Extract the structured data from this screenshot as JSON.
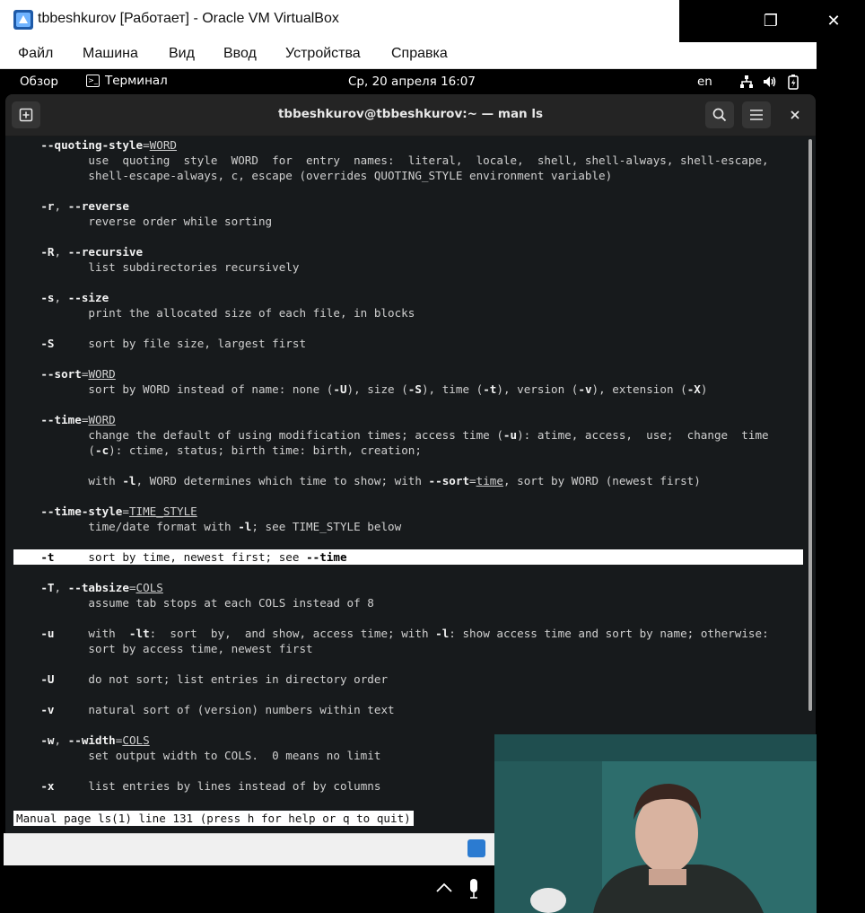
{
  "window": {
    "title": "tbbeshkurov [Работает] - Oracle VM VirtualBox",
    "controls": [
      "—",
      "❐",
      "✕"
    ]
  },
  "menubar": [
    "Файл",
    "Машина",
    "Вид",
    "Ввод",
    "Устройства",
    "Справка"
  ],
  "gnome_topbar": {
    "overview": "Обзор",
    "app": "Терминал",
    "clock": "Ср, 20 апреля  16:07",
    "lang": "en"
  },
  "terminal": {
    "title": "tbbeshkurov@tbbeshkurov:~ — man ls",
    "lines": [
      {
        "html": "    <b>--quoting-style</b>=<u>WORD</u>"
      },
      {
        "html": "           use  quoting  style  WORD  for  entry  names:  literal,  locale,  shell, shell-always, shell-escape,"
      },
      {
        "html": "           shell-escape-always, c, escape (overrides QUOTING_STYLE environment variable)"
      },
      {
        "html": ""
      },
      {
        "html": "    <b>-r</b>, <b>--reverse</b>"
      },
      {
        "html": "           reverse order while sorting"
      },
      {
        "html": ""
      },
      {
        "html": "    <b>-R</b>, <b>--recursive</b>"
      },
      {
        "html": "           list subdirectories recursively"
      },
      {
        "html": ""
      },
      {
        "html": "    <b>-s</b>, <b>--size</b>"
      },
      {
        "html": "           print the allocated size of each file, in blocks"
      },
      {
        "html": ""
      },
      {
        "html": "    <b>-S</b>     sort by file size, largest first"
      },
      {
        "html": ""
      },
      {
        "html": "    <b>--sort</b>=<u>WORD</u>"
      },
      {
        "html": "           sort by WORD instead of name: none (<b>-U</b>), size (<b>-S</b>), time (<b>-t</b>), version (<b>-v</b>), extension (<b>-X</b>)"
      },
      {
        "html": ""
      },
      {
        "html": "    <b>--time</b>=<u>WORD</u>"
      },
      {
        "html": "           change the default of using modification times; access time (<b>-u</b>): atime, access,  use;  change  time"
      },
      {
        "html": "           (<b>-c</b>): ctime, status; birth time: birth, creation;"
      },
      {
        "html": ""
      },
      {
        "html": "           with <b>-l</b>, WORD determines which time to show; with <b>--sort</b>=<u>time</u>, sort by WORD (newest first)"
      },
      {
        "html": ""
      },
      {
        "html": "    <b>--time-style</b>=<u>TIME_STYLE</u>"
      },
      {
        "html": "           time/date format with <b>-l</b>; see TIME_STYLE below"
      },
      {
        "html": ""
      },
      {
        "html": "    <b>-t</b>     sort by time, newest first; see <b>--time</b>",
        "highlight": true
      },
      {
        "html": ""
      },
      {
        "html": "    <b>-T</b>, <b>--tabsize</b>=<u>COLS</u>"
      },
      {
        "html": "           assume tab stops at each COLS instead of 8"
      },
      {
        "html": ""
      },
      {
        "html": "    <b>-u</b>     with  <b>-lt</b>:  sort  by,  and show, access time; with <b>-l</b>: show access time and sort by name; otherwise:"
      },
      {
        "html": "           sort by access time, newest first"
      },
      {
        "html": ""
      },
      {
        "html": "    <b>-U</b>     do not sort; list entries in directory order"
      },
      {
        "html": ""
      },
      {
        "html": "    <b>-v</b>     natural sort of (version) numbers within text"
      },
      {
        "html": ""
      },
      {
        "html": "    <b>-w</b>, <b>--width</b>=<u>COLS</u>"
      },
      {
        "html": "           set output width to COLS.  0 means no limit"
      },
      {
        "html": ""
      },
      {
        "html": "    <b>-x</b>     list entries by lines instead of by columns"
      }
    ],
    "status": "Manual page ls(1) line 131 (press h for help or q to quit)"
  }
}
